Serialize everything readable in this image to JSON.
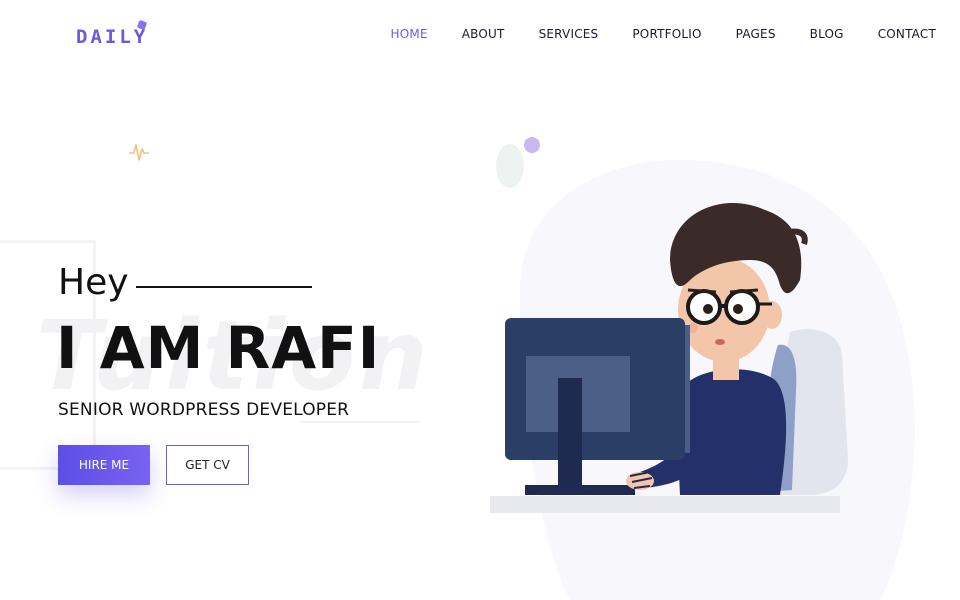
{
  "brand": {
    "logo_text": "DAILY"
  },
  "nav": [
    {
      "label": "HOME",
      "active": true
    },
    {
      "label": "ABOUT"
    },
    {
      "label": "SERVICES"
    },
    {
      "label": "PORTFOLIO"
    },
    {
      "label": "PAGES"
    },
    {
      "label": "BLOG"
    },
    {
      "label": "CONTACT"
    }
  ],
  "hero": {
    "greeting": "Hey",
    "name": "I AM RAFI",
    "role": "SENIOR WORDPRESS DEVELOPER",
    "background_word": "Tuition",
    "hire_label": "HIRE ME",
    "cv_label": "GET CV"
  },
  "colors": {
    "accent": "#6c5ce7",
    "text": "#111111",
    "blob": "#f7f7fc",
    "monitor": "#2b3f66"
  },
  "icons": {
    "pulse": "pulse-icon",
    "illustration": "developer-at-computer-illustration"
  }
}
